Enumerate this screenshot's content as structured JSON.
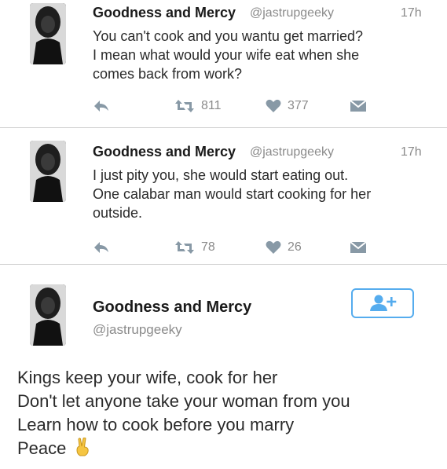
{
  "tweets": [
    {
      "name": "Goodness and Mercy",
      "handle": "@jastrupgeeky",
      "time": "17h",
      "text_lines": [
        "You can't cook and you wantu get married?",
        "I mean what would your wife eat when she",
        "comes back from work?"
      ],
      "retweets": "811",
      "likes": "377"
    },
    {
      "name": "Goodness and Mercy",
      "handle": "@jastrupgeeky",
      "time": "17h",
      "text_lines": [
        "I just pity you, she would start eating out.",
        "One calabar man would start cooking for her",
        "outside."
      ],
      "retweets": "78",
      "likes": "26"
    }
  ],
  "profile": {
    "name": "Goodness and Mercy",
    "handle": "@jastrupgeeky",
    "follow_icon": "add-user-icon"
  },
  "caption_lines": [
    "Kings keep your wife, cook for her",
    "Don't let anyone take your woman from you",
    "Learn how to cook before you marry",
    "Peace"
  ],
  "caption_emoji": "victory-hand-emoji",
  "colors": {
    "accent": "#55acee",
    "meta_gray": "#8b8b8b",
    "icon_gray": "#8899a6"
  }
}
